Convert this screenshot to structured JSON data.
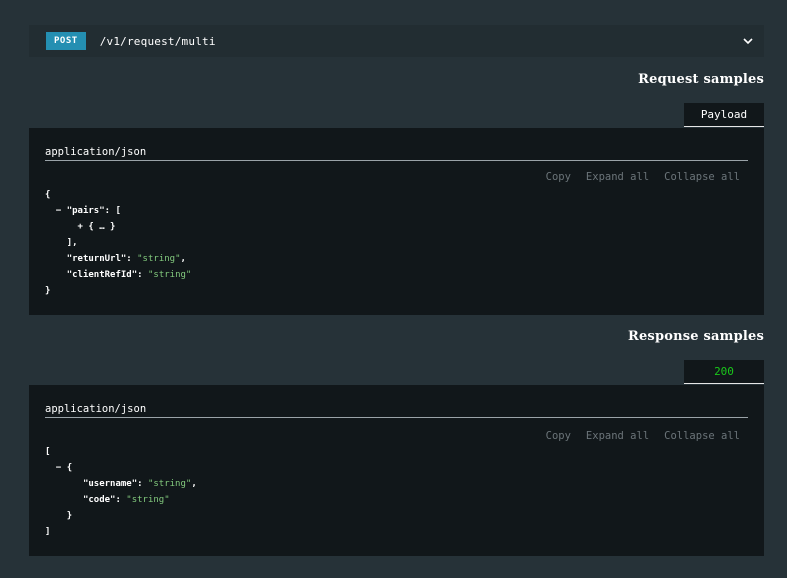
{
  "endpoint": {
    "method": "POST",
    "path": "/v1/request/multi",
    "expand_icon": "chevron-down-icon"
  },
  "request": {
    "title": "Request samples",
    "tab_label": "Payload",
    "content_type": "application/json",
    "actions": {
      "copy": "Copy",
      "expand_all": "Expand all",
      "collapse_all": "Collapse all"
    },
    "code": {
      "open": "{",
      "pairs_toggle": "−",
      "pairs_key": "\"pairs\"",
      "pairs_open": ": [",
      "pairs_item": "+ { … }",
      "pairs_close": "],",
      "return_key": "\"returnUrl\"",
      "return_val": "\"string\"",
      "client_key": "\"clientRefId\"",
      "client_val": "\"string\"",
      "close": "}"
    }
  },
  "response": {
    "title": "Response samples",
    "tab_label": "200",
    "content_type": "application/json",
    "actions": {
      "copy": "Copy",
      "expand_all": "Expand all",
      "collapse_all": "Collapse all"
    },
    "code": {
      "open": "[",
      "item_toggle": "−",
      "item_open": "{",
      "username_key": "\"username\"",
      "username_val": "\"string\"",
      "code_key": "\"code\"",
      "code_val": "\"string\"",
      "item_close": "}",
      "close": "]"
    }
  }
}
